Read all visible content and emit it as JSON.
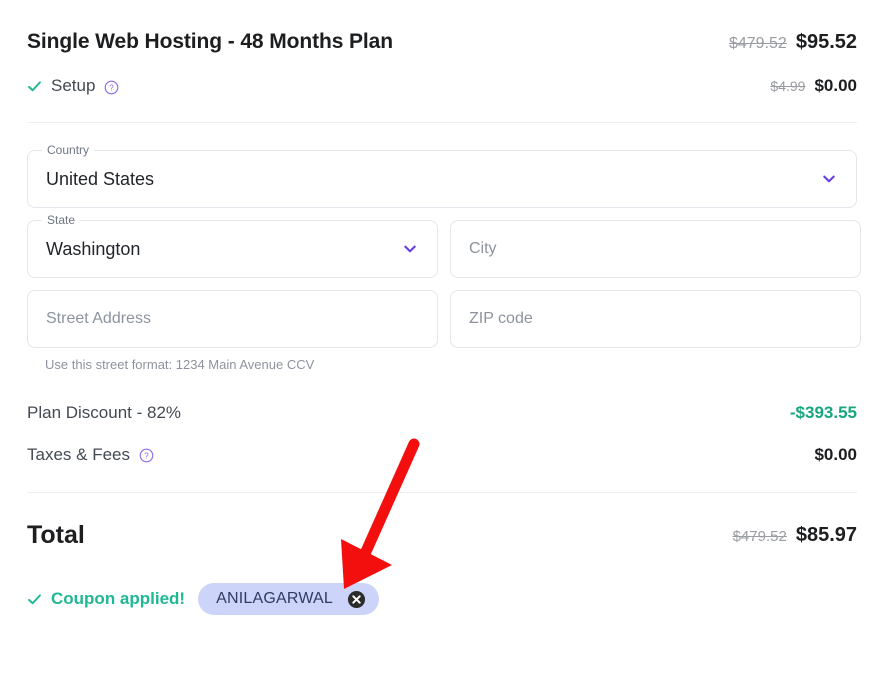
{
  "plan": {
    "title": "Single Web Hosting - 48 Months Plan",
    "price_old": "$479.52",
    "price_new": "$95.52"
  },
  "setup": {
    "label": "Setup",
    "check_icon": "check-icon",
    "info_icon": "info-circle-icon",
    "price_old": "$4.99",
    "price_new": "$0.00"
  },
  "form": {
    "country": {
      "legend": "Country",
      "value": "United States",
      "chevron_icon": "chevron-down-icon"
    },
    "state": {
      "legend": "State",
      "value": "Washington",
      "chevron_icon": "chevron-down-icon"
    },
    "city": {
      "placeholder": "City",
      "value": ""
    },
    "street": {
      "placeholder": "Street Address",
      "value": "",
      "hint": "Use this street format: 1234 Main Avenue CCV"
    },
    "zip": {
      "placeholder": "ZIP code",
      "value": ""
    }
  },
  "summary": {
    "discount_label": "Plan Discount - 82%",
    "discount_value": "-$393.55",
    "taxes_label": "Taxes & Fees",
    "taxes_info_icon": "info-circle-icon",
    "taxes_value": "$0.00"
  },
  "total": {
    "label": "Total",
    "price_old": "$479.52",
    "price_new": "$85.97"
  },
  "coupon": {
    "check_icon": "check-icon",
    "applied_text": "Coupon applied!",
    "code": "ANILAGARWAL",
    "remove_icon": "close-circle-icon"
  },
  "colors": {
    "accent_purple": "#673de6",
    "success_green": "#20b894",
    "discount_green": "#17a67f",
    "text_dark": "#1d1e20",
    "text_muted": "#8d939e",
    "chip_bg": "#ccd4fa",
    "annotation_red": "#f40f0f"
  }
}
